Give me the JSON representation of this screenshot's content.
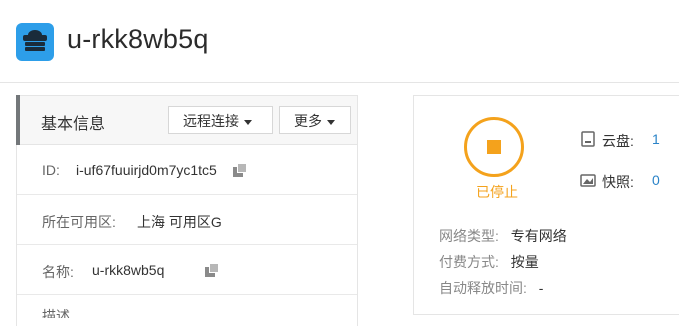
{
  "header": {
    "title": "u-rkk8wb5q",
    "icon": "cloud-server-icon"
  },
  "basic": {
    "title": "基本信息",
    "remote_btn": "远程连接",
    "more_btn": "更多",
    "rows": [
      {
        "label": "ID:",
        "value": "i-uf67fuuirjd0m7yc1tc5"
      },
      {
        "label": "所在可用区:",
        "value": "上海 可用区G"
      },
      {
        "label": "名称:",
        "value": "u-rkk8wb5q"
      }
    ],
    "partial_label": "描述"
  },
  "status": {
    "label": "已停止",
    "color": "#f4a21c"
  },
  "resources": {
    "disk_label": "云盘:",
    "disk_count": "1",
    "snapshot_label": "快照:",
    "snapshot_count": "0"
  },
  "meta": {
    "network_key": "网络类型:",
    "network_val": "专有网络",
    "billing_key": "付费方式:",
    "billing_val": "按量",
    "release_key": "自动释放时间:",
    "release_val": "-"
  }
}
